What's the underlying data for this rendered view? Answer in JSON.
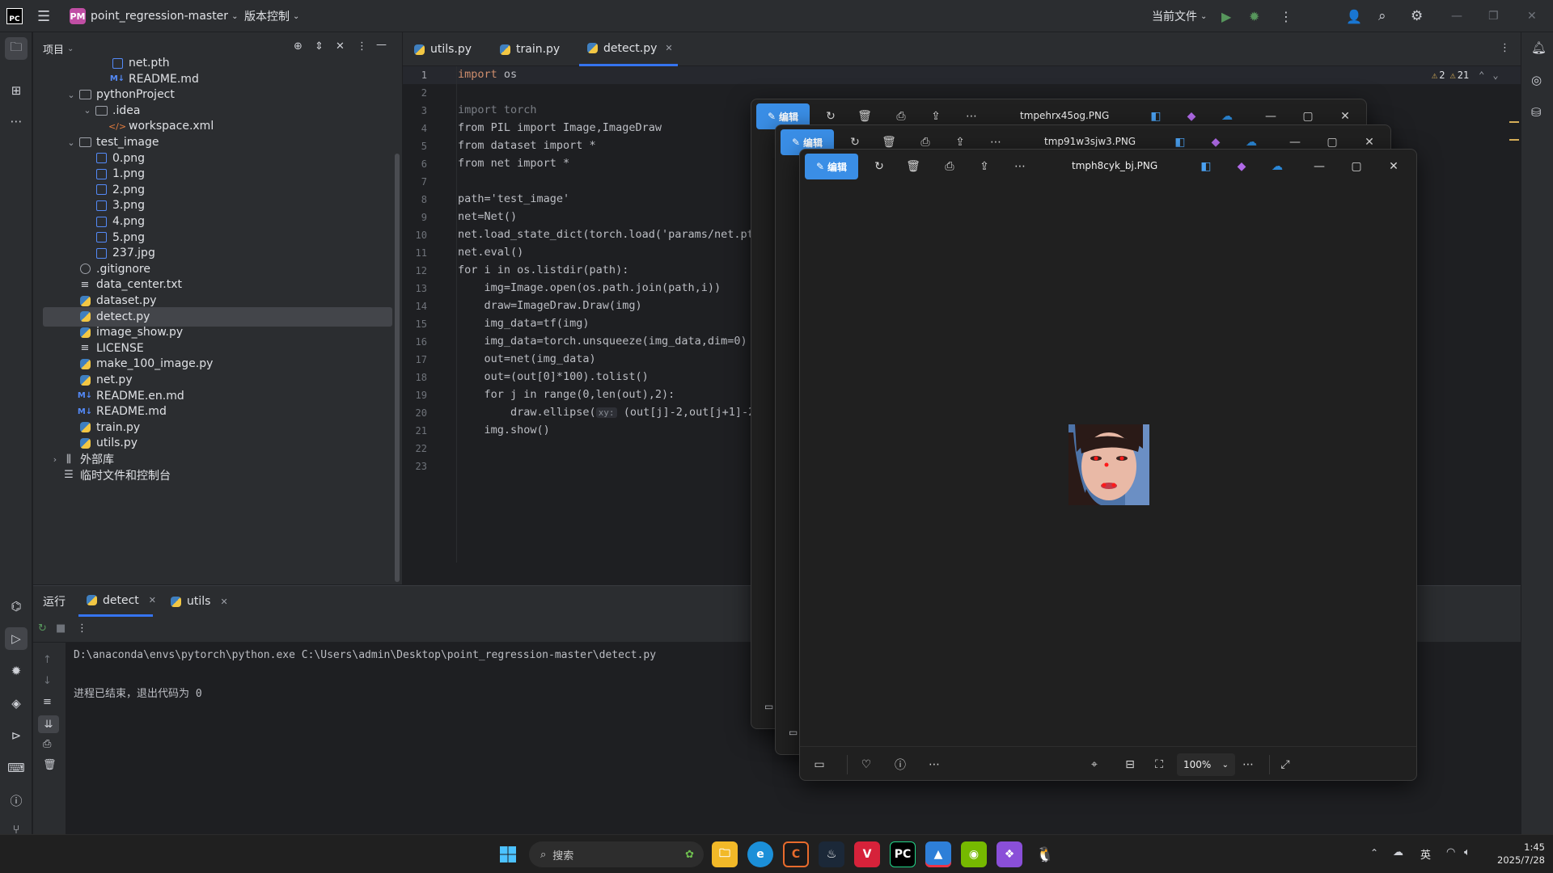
{
  "titlebar": {
    "project_badge": "PM",
    "project_name": "point_regression-master",
    "vcs_label": "版本控制",
    "run_config": "当前文件"
  },
  "project_panel": {
    "title": "项目",
    "tree": [
      {
        "label": "net.pth",
        "icon": "file-icon",
        "depth": 3
      },
      {
        "label": "README.md",
        "icon": "markdown-icon",
        "depth": 3
      },
      {
        "label": "pythonProject",
        "icon": "folder-icon",
        "depth": 1,
        "expanded": true
      },
      {
        "label": ".idea",
        "icon": "folder-icon",
        "depth": 2,
        "expanded": true
      },
      {
        "label": "workspace.xml",
        "icon": "xml-icon",
        "depth": 3
      },
      {
        "label": "test_image",
        "icon": "folder-icon",
        "depth": 1,
        "expanded": true
      },
      {
        "label": "0.png",
        "icon": "image-icon",
        "depth": 2
      },
      {
        "label": "1.png",
        "icon": "image-icon",
        "depth": 2
      },
      {
        "label": "2.png",
        "icon": "image-icon",
        "depth": 2
      },
      {
        "label": "3.png",
        "icon": "image-icon",
        "depth": 2
      },
      {
        "label": "4.png",
        "icon": "image-icon",
        "depth": 2
      },
      {
        "label": "5.png",
        "icon": "image-icon",
        "depth": 2
      },
      {
        "label": "237.jpg",
        "icon": "image-icon",
        "depth": 2
      },
      {
        "label": ".gitignore",
        "icon": "ignore-icon",
        "depth": 1
      },
      {
        "label": "data_center.txt",
        "icon": "text-icon",
        "depth": 1
      },
      {
        "label": "dataset.py",
        "icon": "python-icon",
        "depth": 1
      },
      {
        "label": "detect.py",
        "icon": "python-icon",
        "depth": 1,
        "selected": true
      },
      {
        "label": "image_show.py",
        "icon": "python-icon",
        "depth": 1
      },
      {
        "label": "LICENSE",
        "icon": "text-icon",
        "depth": 1
      },
      {
        "label": "make_100_image.py",
        "icon": "python-icon",
        "depth": 1
      },
      {
        "label": "net.py",
        "icon": "python-icon",
        "depth": 1
      },
      {
        "label": "README.en.md",
        "icon": "markdown-icon",
        "depth": 1
      },
      {
        "label": "README.md",
        "icon": "markdown-icon",
        "depth": 1
      },
      {
        "label": "train.py",
        "icon": "python-icon",
        "depth": 1
      },
      {
        "label": "utils.py",
        "icon": "python-icon",
        "depth": 1
      },
      {
        "label": "外部库",
        "icon": "library-icon",
        "depth": 0,
        "expanded": false
      },
      {
        "label": "临时文件和控制台",
        "icon": "scratch-icon",
        "depth": 0
      }
    ]
  },
  "editor": {
    "tabs": [
      {
        "label": "utils.py",
        "active": false
      },
      {
        "label": "train.py",
        "active": false
      },
      {
        "label": "detect.py",
        "active": true
      }
    ],
    "warnings_weak": "2",
    "warnings": "21",
    "line_numbers": [
      "1",
      "2",
      "3",
      "4",
      "5",
      "6",
      "7",
      "8",
      "9",
      "10",
      "11",
      "12",
      "13",
      "14",
      "15",
      "16",
      "17",
      "18",
      "19",
      "20",
      "21",
      "22",
      "23"
    ],
    "code": {
      "l1": "import os",
      "l3": "import torch",
      "l4": "from PIL import Image,ImageDraw",
      "l5": "from dataset import *",
      "l6": "from net import *",
      "l8": "path='test_image'",
      "l9": "net=Net()",
      "l10": "net.load_state_dict(torch.load('params/net.pth",
      "l11": "net.eval()",
      "l12": "for i in os.listdir(path):",
      "l13": "    img=Image.open(os.path.join(path,i))",
      "l14": "    draw=ImageDraw.Draw(img)",
      "l15": "    img_data=tf(img)",
      "l16": "    img_data=torch.unsqueeze(img_data,dim=0)",
      "l17": "    out=net(img_data)",
      "l18": "    out=(out[0]*100).tolist()",
      "l19": "    for j in range(0,len(out),2):",
      "l20": "        draw.ellipse(",
      "l20_hint": "xy:",
      "l20_rest": "(out[j]-2,out[j+1]-2,",
      "l21": "    img.show()"
    }
  },
  "run_panel": {
    "label": "运行",
    "tabs": [
      {
        "label": "detect",
        "active": true
      },
      {
        "label": "utils",
        "active": false
      }
    ],
    "output_cmd": "D:\\anaconda\\envs\\pytorch\\python.exe C:\\Users\\admin\\Desktop\\point_regression-master\\detect.py",
    "output_exit": "进程已结束，退出代码为 0"
  },
  "photo_windows": [
    {
      "edit_label": "编辑",
      "title": "tmpehrx45og.PNG"
    },
    {
      "edit_label": "编辑",
      "title": "tmp91w3sjw3.PNG"
    },
    {
      "edit_label": "编辑",
      "title": "tmph8cyk_bj.PNG",
      "zoom": "100%"
    }
  ],
  "taskbar": {
    "search_placeholder": "搜索",
    "ime": "英",
    "time": "1:45",
    "date": "2025/7/28"
  },
  "colors": {
    "accent": "#3574f0",
    "photos_edit": "#3a8ee6",
    "pycharm_badge": "#c04ea4"
  }
}
